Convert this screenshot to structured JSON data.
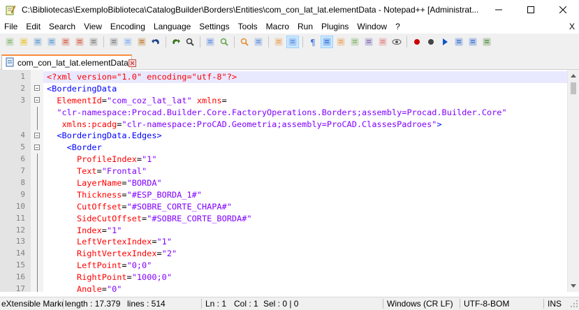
{
  "window": {
    "title": "C:\\Bibliotecas\\ExemploBiblioteca\\CatalogBuilder\\Borders\\Entities\\com_con_lat_lat.elementData - Notepad++ [Administrat..."
  },
  "menu": {
    "items": [
      "File",
      "Edit",
      "Search",
      "View",
      "Encoding",
      "Language",
      "Settings",
      "Tools",
      "Macro",
      "Run",
      "Plugins",
      "Window",
      "?"
    ],
    "close_label": "X"
  },
  "tab": {
    "label": "com_con_lat_lat.elementData"
  },
  "editor": {
    "lines": [
      {
        "n": "1",
        "fold": "",
        "parts": [
          [
            "c-pi",
            "<?xml version=\"1.0\" encoding=\"utf-8\"?>"
          ]
        ],
        "indent": ""
      },
      {
        "n": "2",
        "fold": "box",
        "parts": [
          [
            "c-tag",
            "<BorderingData"
          ]
        ],
        "indent": ""
      },
      {
        "n": "3",
        "fold": "box",
        "parts": [
          [
            "c-attr",
            "ElementId"
          ],
          [
            "c-eq",
            "="
          ],
          [
            "c-val",
            "\"com_coz_lat_lat\""
          ],
          [
            "c-eq",
            " "
          ],
          [
            "c-attr",
            "xmlns"
          ],
          [
            "c-eq",
            "="
          ]
        ],
        "indent": "  "
      },
      {
        "n": "",
        "fold": "line",
        "parts": [
          [
            "c-val",
            "\"clr-namespace:Procad.Builder.Core.FactoryOperations.Borders;assembly=Procad.Builder.Core\""
          ]
        ],
        "indent": "  "
      },
      {
        "n": "",
        "fold": "line",
        "parts": [
          [
            "c-attr",
            "xmlns:pcadg"
          ],
          [
            "c-eq",
            "="
          ],
          [
            "c-val",
            "\"clr-namespace:ProCAD.Geometria;assembly=ProCAD.ClassesPadroes\""
          ],
          [
            "c-tag",
            ">"
          ]
        ],
        "indent": "   "
      },
      {
        "n": "4",
        "fold": "box",
        "parts": [
          [
            "c-tag",
            "<BorderingData.Edges>"
          ]
        ],
        "indent": "  "
      },
      {
        "n": "5",
        "fold": "box",
        "parts": [
          [
            "c-tag",
            "<Border"
          ]
        ],
        "indent": "    "
      },
      {
        "n": "6",
        "fold": "line",
        "parts": [
          [
            "c-attr",
            "ProfileIndex"
          ],
          [
            "c-eq",
            "="
          ],
          [
            "c-val",
            "\"1\""
          ]
        ],
        "indent": "      "
      },
      {
        "n": "7",
        "fold": "line",
        "parts": [
          [
            "c-attr",
            "Text"
          ],
          [
            "c-eq",
            "="
          ],
          [
            "c-val",
            "\"Frontal\""
          ]
        ],
        "indent": "      "
      },
      {
        "n": "8",
        "fold": "line",
        "parts": [
          [
            "c-attr",
            "LayerName"
          ],
          [
            "c-eq",
            "="
          ],
          [
            "c-val",
            "\"BORDA\""
          ]
        ],
        "indent": "      "
      },
      {
        "n": "9",
        "fold": "line",
        "parts": [
          [
            "c-attr",
            "Thickness"
          ],
          [
            "c-eq",
            "="
          ],
          [
            "c-val",
            "\"#ESP_BORDA_1#\""
          ]
        ],
        "indent": "      "
      },
      {
        "n": "10",
        "fold": "line",
        "parts": [
          [
            "c-attr",
            "CutOffset"
          ],
          [
            "c-eq",
            "="
          ],
          [
            "c-val",
            "\"#SOBRE_CORTE_CHAPA#\""
          ]
        ],
        "indent": "      "
      },
      {
        "n": "11",
        "fold": "line",
        "parts": [
          [
            "c-attr",
            "SideCutOffset"
          ],
          [
            "c-eq",
            "="
          ],
          [
            "c-val",
            "\"#SOBRE_CORTE_BORDA#\""
          ]
        ],
        "indent": "      "
      },
      {
        "n": "12",
        "fold": "line",
        "parts": [
          [
            "c-attr",
            "Index"
          ],
          [
            "c-eq",
            "="
          ],
          [
            "c-val",
            "\"1\""
          ]
        ],
        "indent": "      "
      },
      {
        "n": "13",
        "fold": "line",
        "parts": [
          [
            "c-attr",
            "LeftVertexIndex"
          ],
          [
            "c-eq",
            "="
          ],
          [
            "c-val",
            "\"1\""
          ]
        ],
        "indent": "      "
      },
      {
        "n": "14",
        "fold": "line",
        "parts": [
          [
            "c-attr",
            "RightVertexIndex"
          ],
          [
            "c-eq",
            "="
          ],
          [
            "c-val",
            "\"2\""
          ]
        ],
        "indent": "      "
      },
      {
        "n": "15",
        "fold": "line",
        "parts": [
          [
            "c-attr",
            "LeftPoint"
          ],
          [
            "c-eq",
            "="
          ],
          [
            "c-val",
            "\"0;0\""
          ]
        ],
        "indent": "      "
      },
      {
        "n": "16",
        "fold": "line",
        "parts": [
          [
            "c-attr",
            "RightPoint"
          ],
          [
            "c-eq",
            "="
          ],
          [
            "c-val",
            "\"1000;0\""
          ]
        ],
        "indent": "      "
      },
      {
        "n": "17",
        "fold": "line",
        "parts": [
          [
            "c-attr",
            "Angle"
          ],
          [
            "c-eq",
            "="
          ],
          [
            "c-val",
            "\"0\""
          ]
        ],
        "indent": "      "
      }
    ]
  },
  "status": {
    "language": "eXtensible Marku",
    "length": "length : 17.379",
    "lines": "lines : 514",
    "ln": "Ln : 1",
    "col": "Col : 1",
    "sel": "Sel : 0 | 0",
    "eol": "Windows (CR LF)",
    "encoding": "UTF-8-BOM",
    "mode": "INS"
  },
  "icons": {
    "toolbar": [
      "new-file-icon",
      "open-file-icon",
      "save-icon",
      "save-all-icon",
      "close-icon",
      "close-all-icon",
      "print-icon",
      "cut-icon",
      "copy-icon",
      "paste-icon",
      "undo-icon",
      "redo-icon",
      "find-icon",
      "replace-icon",
      "zoom-in-icon",
      "zoom-out-icon",
      "sync-vertical-icon",
      "sync-horizontal-icon",
      "word-wrap-icon",
      "show-all-chars-icon",
      "indent-guide-icon",
      "user-language-icon",
      "doc-map-icon",
      "function-list-icon",
      "folder-workspace-icon",
      "monitoring-icon",
      "record-macro-icon",
      "stop-record-icon",
      "play-macro-icon",
      "run-macro-multiple-icon",
      "save-macro-icon",
      "plugin-icon"
    ]
  }
}
